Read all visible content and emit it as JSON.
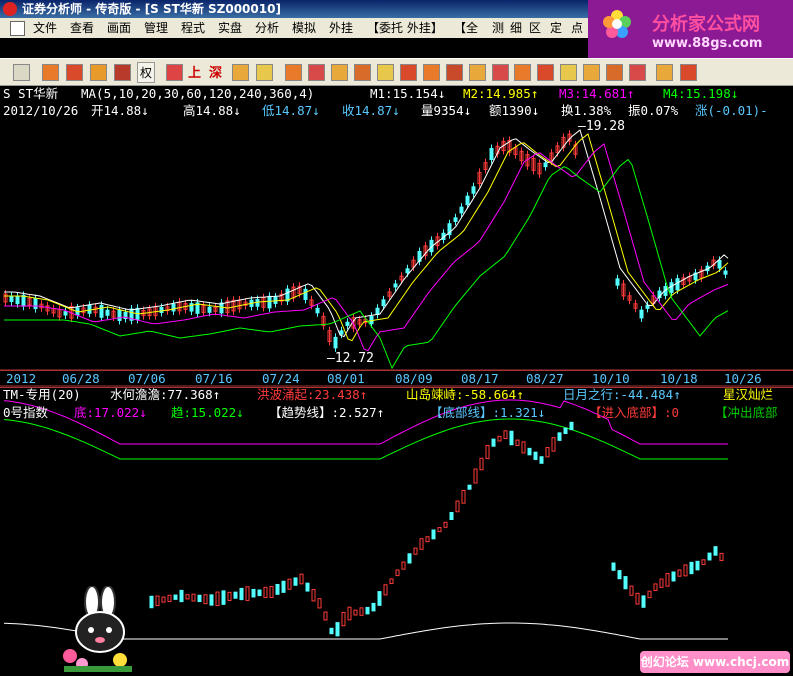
{
  "window": {
    "title_prefix": "证券分析师 - 传奇版 - ",
    "title_stock": "[S ST华新 SZ000010]"
  },
  "menu": [
    "文件",
    "查看",
    "画面",
    "管理",
    "程式",
    "实盘",
    "分析",
    "模拟",
    "外挂",
    "【委托 外挂】",
    "【全",
    "测",
    "细",
    "区",
    "定",
    "点"
  ],
  "toolbar": {
    "quan_label": "权",
    "shang_char": "上",
    "shen_char": "深"
  },
  "banner": {
    "name": "分析家公式网",
    "url": "www.88gs.com"
  },
  "price_panel": {
    "stock_name": "S ST华新",
    "ma_label": "MA(5,10,20,30,60,120,240,360,4)",
    "m1": "M1:15.154↓",
    "m2": "M2:14.985↑",
    "m3": "M3:14.681↑",
    "m4": "M4:15.198↓",
    "date": "2012/10/26",
    "open": "开14.88↓",
    "high": "高14.88↓",
    "low": "低14.87↓",
    "close": "收14.87↓",
    "volume": "量9354↓",
    "amount": "额1390↓",
    "turnover": "换1.38%",
    "amplitude": "振0.07%",
    "change": "涨(-0.01)-",
    "max_label": "19.28",
    "min_label": "12.72"
  },
  "date_axis": [
    "2012",
    "06/28",
    "07/06",
    "07/16",
    "07/24",
    "08/01",
    "08/09",
    "08/17",
    "08/27",
    "10/10",
    "10/18",
    "10/26"
  ],
  "indicator_panel": {
    "row1": {
      "title": "TM-专用(20)",
      "i1": "水何澹澹:77.368↑",
      "i2": "洪波涌起:23.438↑",
      "i3": "山岛竦峙:-58.664↑",
      "i4": "日月之行:-44.484↑",
      "i5": "星汉灿烂"
    },
    "row2": {
      "title": "0号指数",
      "i1": "底:17.022↓",
      "i2": "趋:15.022↓",
      "i3": "【趋势线】:2.527↑",
      "i4": "【底部线】:1.321↓",
      "i5": "【进入底部】:0",
      "i6": "【冲出底部"
    }
  },
  "watermark": "创幻论坛 www.chcj.com",
  "colors": {
    "bg": "#000000",
    "up": "#ff3b3b",
    "down": "#54ffff",
    "ma_white": "#ffffff",
    "ma_yellow": "#ffff00",
    "ma_magenta": "#ff00ff",
    "ma_green": "#00ff00",
    "axis_blue": "#5ac8ff"
  }
}
